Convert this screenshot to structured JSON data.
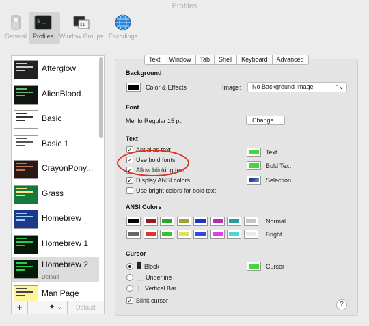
{
  "window": {
    "title": "Profiles"
  },
  "toolbar": {
    "items": [
      {
        "label": "General",
        "icon": "switch-icon"
      },
      {
        "label": "Profiles",
        "icon": "terminal-icon"
      },
      {
        "label": "Window Groups",
        "icon": "window-groups-icon"
      },
      {
        "label": "Encodings",
        "icon": "globe-icon"
      }
    ]
  },
  "profiles": [
    {
      "name": "Afterglow",
      "bg": "#222222",
      "fg": "#cccccc"
    },
    {
      "name": "AlienBlood",
      "bg": "#0f1610",
      "fg": "#6fb46f"
    },
    {
      "name": "Basic",
      "bg": "#ffffff",
      "fg": "#333333"
    },
    {
      "name": "Basic 1",
      "bg": "#ffffff",
      "fg": "#555555"
    },
    {
      "name": "CrayonPony...",
      "bg": "#2a1a14",
      "fg": "#bb7755"
    },
    {
      "name": "Grass",
      "bg": "#137a3b",
      "fg": "#ffe680"
    },
    {
      "name": "Homebrew",
      "bg": "#1c3a8c",
      "fg": "#9fd0ff"
    },
    {
      "name": "Homebrew 1",
      "bg": "#061a0a",
      "fg": "#27c94b"
    },
    {
      "name": "Homebrew 2",
      "sub": "Default",
      "bg": "#061a0a",
      "fg": "#27c94b",
      "selected": true
    },
    {
      "name": "Man Page",
      "bg": "#fef49c",
      "fg": "#444444"
    }
  ],
  "list_footer": {
    "add": "+",
    "remove": "—",
    "action": "✷ ⌄",
    "default_label": "Default"
  },
  "tabs": [
    "Text",
    "Window",
    "Tab",
    "Shell",
    "Keyboard",
    "Advanced"
  ],
  "active_tab": "Text",
  "background": {
    "heading": "Background",
    "color_effects_label": "Color & Effects",
    "image_label": "Image:",
    "image_value": "No Background Image"
  },
  "font": {
    "heading": "Font",
    "value": "Menlo Regular 15 pt.",
    "change_label": "Change..."
  },
  "text": {
    "heading": "Text",
    "antialias_label": "Antialias text",
    "options": [
      {
        "label": "Use bold fonts",
        "checked": true
      },
      {
        "label": "Allow blinking text",
        "checked": true
      },
      {
        "label": "Display ANSI colors",
        "checked": true
      },
      {
        "label": "Use bright colors for bold text",
        "checked": false
      }
    ],
    "color_labels": {
      "text": "Text",
      "bold": "Bold Text",
      "selection": "Selection"
    }
  },
  "ansi": {
    "heading": "ANSI Colors",
    "normal_label": "Normal",
    "bright_label": "Bright",
    "normal": [
      "#000000",
      "#9a1624",
      "#31a331",
      "#a0a035",
      "#1b32c6",
      "#b42fb4",
      "#2a9c9c",
      "#c6c6c6"
    ],
    "bright": [
      "#666666",
      "#e23131",
      "#34c234",
      "#e3e34c",
      "#3347e3",
      "#e33ee3",
      "#4ed6d6",
      "#eaeaea"
    ]
  },
  "cursor": {
    "heading": "Cursor",
    "options": [
      {
        "label": "Block",
        "selected": true
      },
      {
        "label": "Underline",
        "selected": false
      },
      {
        "label": "Vertical Bar",
        "selected": false
      }
    ],
    "blink_label": "Blink cursor",
    "color_label": "Cursor"
  },
  "colors": {
    "text_swatch": "#3fd93f",
    "bold_swatch": "#3fd93f",
    "selection_swatch": "#2a3aa0",
    "cursor_swatch": "#3fd93f",
    "background_swatch": "#000000",
    "annotation": "#d9341f"
  },
  "help_label": "?"
}
